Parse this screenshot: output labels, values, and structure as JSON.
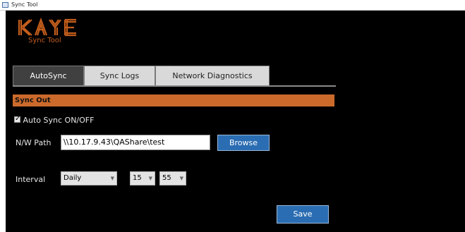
{
  "window": {
    "title": "Sync Tool"
  },
  "logo": {
    "brand": "KAYE",
    "subtitle": "Sync Tool"
  },
  "tabs": [
    {
      "label": "AutoSync",
      "active": true
    },
    {
      "label": "Sync Logs",
      "active": false
    },
    {
      "label": "Network Diagnostics",
      "active": false
    }
  ],
  "sync_out": {
    "section_title": "Sync Out",
    "auto_sync": {
      "label": "Auto Sync ON/OFF",
      "checked": true
    },
    "path": {
      "label": "N/W Path",
      "value": "\\\\10.17.9.43\\QAShare\\test"
    },
    "browse_label": "Browse",
    "interval": {
      "label": "Interval",
      "frequency": "Daily",
      "hour": "15",
      "minute": "55"
    },
    "save_label": "Save"
  },
  "colors": {
    "accent": "#cc6a2b",
    "button": "#2b6db2",
    "background": "#000000"
  }
}
